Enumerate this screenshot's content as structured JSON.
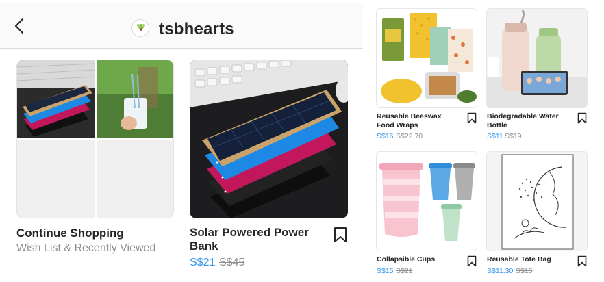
{
  "header": {
    "shop_name": "tsbhearts",
    "avatar_text": "TSB HEARTS"
  },
  "wishlist_tile": {
    "title": "Continue Shopping",
    "subtitle": "Wish List & Recently Viewed"
  },
  "featured_product": {
    "title_line1": "Solar Powered Power",
    "title_line2": "Bank",
    "price": "S$21",
    "old_price": "S$45"
  },
  "products": [
    {
      "title_line1": "Reusable Beeswax",
      "title_line2": "Food Wraps",
      "price": "S$16",
      "old_price": "S$22.70"
    },
    {
      "title_line1": "Biodegradable Water",
      "title_line2": "Bottle",
      "price": "S$11",
      "old_price": "S$19"
    },
    {
      "title_line1": "Collapsible Cups",
      "title_line2": "",
      "price": "S$15",
      "old_price": "S$21"
    },
    {
      "title_line1": "Reusable Tote Bag",
      "title_line2": "",
      "price": "S$11.30",
      "old_price": "S$15"
    }
  ],
  "colors": {
    "price_blue": "#3897f0",
    "text_dark": "#262626",
    "text_grey": "#8e8e8e",
    "header_bg": "#fafafa"
  },
  "icons": [
    "back-chevron-icon",
    "bookmark-icon"
  ]
}
